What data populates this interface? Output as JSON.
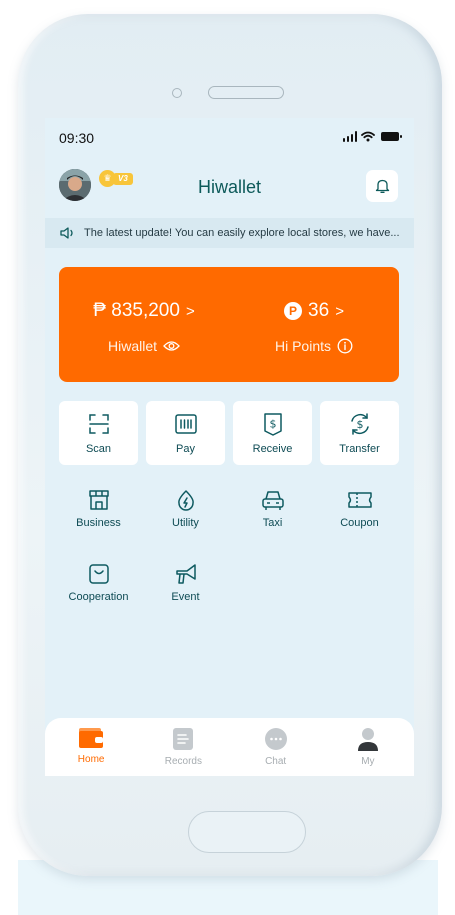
{
  "status_bar": {
    "time": "09:30"
  },
  "header": {
    "title": "Hiwallet",
    "vip_level": "V3"
  },
  "notice": {
    "text": "The latest update! You can easily explore local stores, we have..."
  },
  "balance": {
    "wallet_amount": "₱ 835,200",
    "wallet_label": "Hiwallet",
    "points_amount": "36",
    "points_label": "Hi Points",
    "arrow": ">",
    "points_badge": "P"
  },
  "quick_actions": [
    {
      "label": "Scan",
      "icon": "scan-icon"
    },
    {
      "label": "Pay",
      "icon": "barcode-icon"
    },
    {
      "label": "Receive",
      "icon": "receive-icon"
    },
    {
      "label": "Transfer",
      "icon": "transfer-icon"
    }
  ],
  "services": [
    {
      "label": "Business",
      "icon": "store-icon"
    },
    {
      "label": "Utility",
      "icon": "utility-icon"
    },
    {
      "label": "Taxi",
      "icon": "car-icon"
    },
    {
      "label": "Coupon",
      "icon": "ticket-icon"
    },
    {
      "label": "Cooperation",
      "icon": "bag-icon"
    },
    {
      "label": "Event",
      "icon": "megaphone-icon"
    }
  ],
  "tabs": [
    {
      "label": "Home",
      "active": true
    },
    {
      "label": "Records",
      "active": false
    },
    {
      "label": "Chat",
      "active": false
    },
    {
      "label": "My",
      "active": false
    }
  ],
  "colors": {
    "accent": "#ff6a00",
    "brand": "#0d5a5a",
    "background": "#e3f1f8"
  }
}
